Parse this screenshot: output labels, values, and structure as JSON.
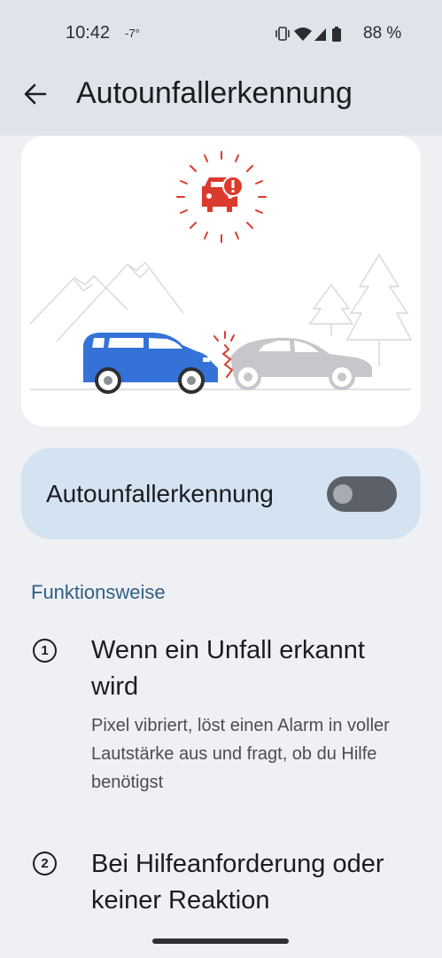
{
  "status_bar": {
    "time": "10:42",
    "temperature": "-7°",
    "battery": "88 %"
  },
  "app_bar": {
    "title": "Autounfallerkennung"
  },
  "toggle": {
    "label": "Autounfallerkennung",
    "enabled": false
  },
  "section": {
    "header": "Funktionsweise"
  },
  "steps": [
    {
      "number": "1",
      "title": "Wenn ein Unfall erkannt wird",
      "description": "Pixel vibriert, löst einen Alarm in voller Lautstärke aus und fragt, ob du Hilfe benötigst"
    },
    {
      "number": "2",
      "title": "Bei Hilfeanforderung oder keiner Reaktion"
    }
  ],
  "colors": {
    "accent_red": "#db3b2d",
    "car_blue": "#3572d8",
    "car_gray": "#c6c7cb",
    "header_blue": "#2f5f85",
    "card_blue": "#d3e3f2"
  }
}
